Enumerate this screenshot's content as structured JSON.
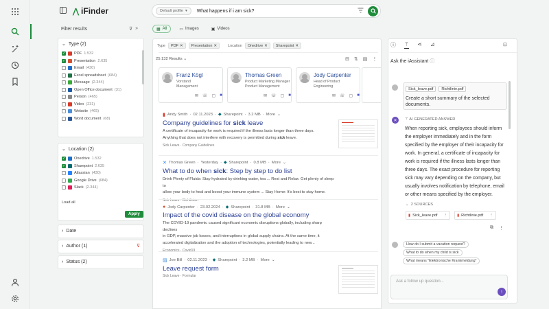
{
  "app": {
    "name": "iFinder"
  },
  "search": {
    "profile": "Default profile",
    "query": "What happens if i am sick?"
  },
  "filters": {
    "title": "Filter results",
    "apply_label": "Apply",
    "load_all": "Load all",
    "type": {
      "label": "Type (2)",
      "items": [
        {
          "label": "PDF",
          "count": "1.532",
          "checked": true,
          "color": "#d73b2a"
        },
        {
          "label": "Presentation",
          "count": "2.635",
          "checked": true,
          "color": "#d35230"
        },
        {
          "label": "Email",
          "count": "(430)",
          "checked": false,
          "color": "#1f6fc7"
        },
        {
          "label": "Excel spreadsheet",
          "count": "(684)",
          "checked": false,
          "color": "#1e7145"
        },
        {
          "label": "Message",
          "count": "(2.344)",
          "checked": false,
          "color": "#3aaa3a"
        },
        {
          "label": "Open Office document",
          "count": "(31)",
          "checked": false,
          "color": "#1c5aa6"
        },
        {
          "label": "Person",
          "count": "(465)",
          "checked": false,
          "color": "#888888"
        },
        {
          "label": "Video",
          "count": "(231)",
          "checked": false,
          "color": "#d73b2a"
        },
        {
          "label": "Website",
          "count": "(465)",
          "checked": false,
          "color": "#4a8fd9"
        },
        {
          "label": "Word document",
          "count": "(68)",
          "checked": false,
          "color": "#2b5797"
        }
      ]
    },
    "location": {
      "label": "Location (2)",
      "items": [
        {
          "label": "Onedrive",
          "count": "1.532",
          "checked": true,
          "color": "#1f6fc7"
        },
        {
          "label": "Sharepoint",
          "count": "2.635",
          "checked": true,
          "color": "#036c70"
        },
        {
          "label": "Atlassian",
          "count": "(430)",
          "checked": false,
          "color": "#2684ff"
        },
        {
          "label": "Google Drive",
          "count": "(684)",
          "checked": false,
          "color": "#34a853"
        },
        {
          "label": "Slack",
          "count": "(2.344)",
          "checked": false,
          "color": "#e01e5a"
        }
      ]
    },
    "date_label": "Date",
    "author_label": "Author (1)",
    "status_label": "Status (2)"
  },
  "tabs": [
    {
      "label": "All",
      "active": true
    },
    {
      "label": "Images",
      "active": false
    },
    {
      "label": "Videos",
      "active": false
    }
  ],
  "active_filters": {
    "type_label": "Type",
    "type_chips": [
      "PDF",
      "Presentation"
    ],
    "location_label": "Location",
    "location_chips": [
      "Onedrive",
      "Sharepoint"
    ]
  },
  "results_count": "25.132 Results",
  "people": [
    {
      "name": "Franz Kögl",
      "role1": "Vorstand",
      "role2": "Management"
    },
    {
      "name": "Thomas Green",
      "role1": "Product Marketing Manager",
      "role2": "Product Management"
    },
    {
      "name": "Jody Carpenter",
      "role1": "Head of Product",
      "role2": "Engineering"
    }
  ],
  "results": [
    {
      "author": "Andy Smith",
      "date": "02.11.2023",
      "source": "Sharepoint",
      "size": "3.2 MB",
      "more": "More",
      "title_pre": "Company guidelines for ",
      "title_hl": "sick",
      "title_post": " leave",
      "desc_line1": "A certificate of incapacity for work is required if the illness lasts longer than three days.",
      "desc_line2_pre": "Anything that does not interfere with recovery is permitted during ",
      "desc_line2_hl": "sick",
      "desc_line2_post": " leave.",
      "tags": "Sick Leave  ·  Company Guidelines"
    },
    {
      "author": "Thomas Green",
      "date": "Yesterday",
      "source": "Sharepoint",
      "size": "0.8 MB",
      "more": "More",
      "title_pre": "What to do when ",
      "title_hl": "sick",
      "title_post": ": Step by step to do list",
      "desc_line1": "Drink Plenty of Fluids: Stay hydrated by drinking water, tea ... Rest and Relax: Get plenty of sleep to",
      "desc_line2_pre": "allow your body to heal and boost your immune system ... Stay Home: It's best to stay home.",
      "desc_line2_hl": "",
      "desc_line2_post": "",
      "tags": "Sick Leave  ·  Richtlinien"
    },
    {
      "author": "Jody Carpenter",
      "date": "23.02.2024",
      "source": "Sharepoint",
      "size": "31.8 MB",
      "more": "More",
      "title_pre": "Impact of the covid disease on the global economy",
      "title_hl": "",
      "title_post": "",
      "desc_line1": "The COVID-19 pandemic caused significant economic disruptions globally, including sharp declines",
      "desc_line2_pre": "in GDP, massive job losses, and interruptions in global supply chains. At the same time, it",
      "desc_line2_hl": "",
      "desc_line2_post": "",
      "desc_line3": "accelerated digitalization and the adoption of technologies, potentially leading to new...",
      "tags": "Economics  ·  Covid19"
    },
    {
      "author": "Joe Bill",
      "date": "02.11.2023",
      "source": "Sharepoint",
      "size": "3.2 MB",
      "more": "More",
      "title_pre": "Leave request form",
      "title_hl": "",
      "title_post": "",
      "tags": "Sick Leave  ·  Formular"
    }
  ],
  "assistant": {
    "title": "Ask the iAssistant",
    "user_files": [
      "Sick_leave.pdf",
      "Richtlinie.pdf"
    ],
    "user_message_line1": "Create a short summary of the selected",
    "user_message_line2": "documents.",
    "ai_label": "AI GENERATED ANSWER",
    "answer_lines": [
      "When reporting sick, employees should inform",
      "the employer immediately and in the form",
      "specified by the employer of their incapacity for",
      "work. In general, a certificate of incapacity for",
      "work is required if the illness lasts longer than",
      "three days. The exact procedure for reporting",
      "sick may vary depending on the company, but",
      "usually involves notification by telephone, email",
      "or other means specified by the employer."
    ],
    "sources_label": "2 SOURCES",
    "sources": [
      "Sick_leave.pdf",
      "Richtlinie.pdf"
    ],
    "suggestions": [
      "How do I submit a vacation request?",
      "What to do when my child is sick",
      "What means \"Elektronische Krankmeldung\""
    ],
    "input_placeholder": "Ask a follow up question..."
  }
}
